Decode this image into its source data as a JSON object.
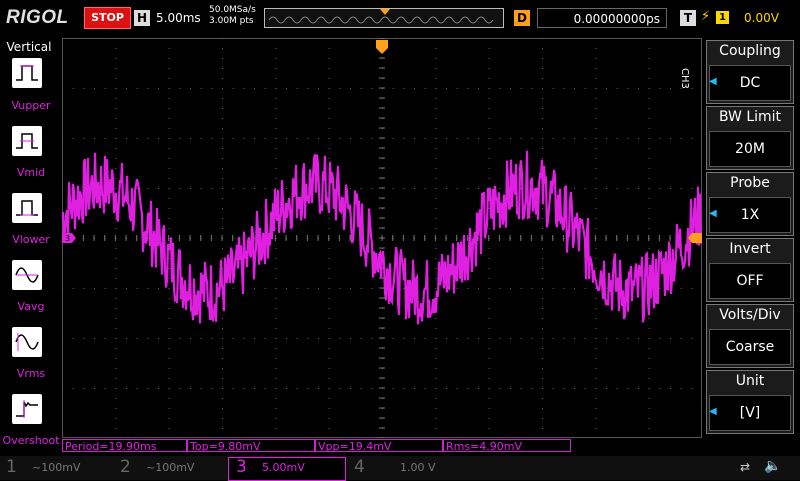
{
  "header": {
    "logo": "RIGOL",
    "run_state": "STOP",
    "horizontal_tag": "H",
    "timebase": "5.00ms",
    "sample_rate": "50.0MSa/s",
    "memory_depth": "3.00M pts",
    "delay_tag": "D",
    "delay": "0.00000000ps",
    "trigger_tag": "T",
    "trigger_edge_icon": "rising-edge-icon",
    "trigger_source": "1",
    "trigger_level": "0.00V"
  },
  "left_menu": {
    "title": "Vertical",
    "items": [
      {
        "label": "Vupper",
        "icon": "vupper-icon"
      },
      {
        "label": "Vmid",
        "icon": "vmid-icon"
      },
      {
        "label": "Vlower",
        "icon": "vlower-icon"
      },
      {
        "label": "Vavg",
        "icon": "vavg-icon"
      },
      {
        "label": "Vrms",
        "icon": "vrms-icon"
      },
      {
        "label": "Overshoot",
        "icon": "overshoot-icon"
      }
    ]
  },
  "right_menu": {
    "channel": "CH3",
    "items": [
      {
        "title": "Coupling",
        "value": "DC",
        "has_arrow": true
      },
      {
        "title": "BW Limit",
        "value": "20M",
        "has_arrow": false
      },
      {
        "title": "Probe",
        "value": "1X",
        "has_arrow": true
      },
      {
        "title": "Invert",
        "value": "OFF",
        "has_arrow": false
      },
      {
        "title": "Volts/Div",
        "value": "Coarse",
        "has_arrow": false
      },
      {
        "title": "Unit",
        "value": "[V]",
        "has_arrow": true
      }
    ]
  },
  "measurements": [
    {
      "label": "Period=19.90ms"
    },
    {
      "label": "Top=9.80mV"
    },
    {
      "label": "Vpp=19.4mV"
    },
    {
      "label": "Rms=4.90mV"
    }
  ],
  "channels": [
    {
      "num": "1",
      "info": "~100mV"
    },
    {
      "num": "2",
      "info": "~100mV"
    },
    {
      "num": "3",
      "info": "5.00mV"
    },
    {
      "num": "4",
      "info": "1.00 V"
    }
  ],
  "marker": {
    "channel_marker": "3"
  },
  "colors": {
    "ch3": "#e020e0",
    "trigger": "#ff9f1a",
    "accent": "#29b6f6",
    "stop": "#dd1111"
  },
  "waveform": {
    "type": "noisy-sine",
    "period_ms": 19.9,
    "vpp_mV": 19.4,
    "volts_per_div_mV": 5.0,
    "time_per_div_ms": 5.0
  }
}
